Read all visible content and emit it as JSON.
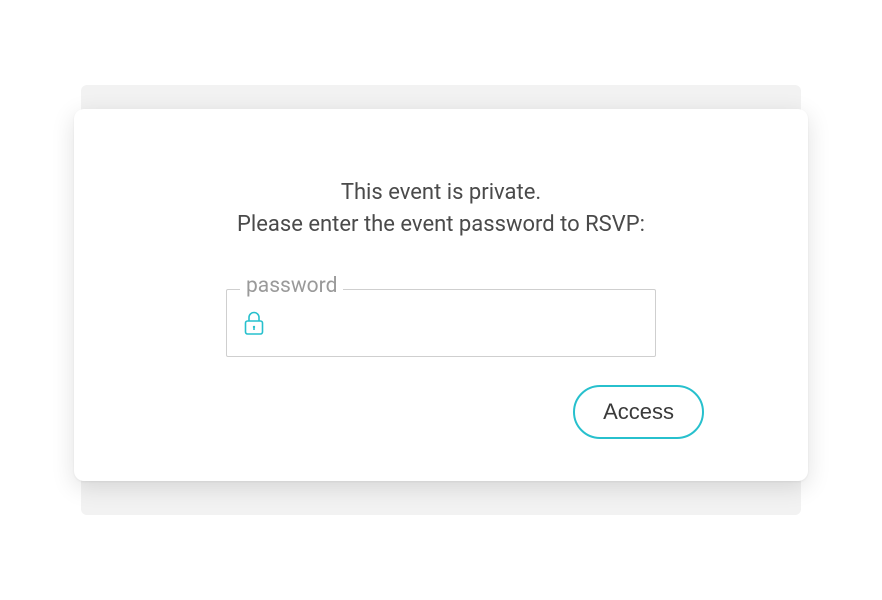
{
  "modal": {
    "message_line1": "This event is private.",
    "message_line2": "Please enter the event password to RSVP:",
    "field_label": "password",
    "password_value": "",
    "access_button_label": "Access"
  },
  "colors": {
    "accent": "#27c0cd"
  }
}
